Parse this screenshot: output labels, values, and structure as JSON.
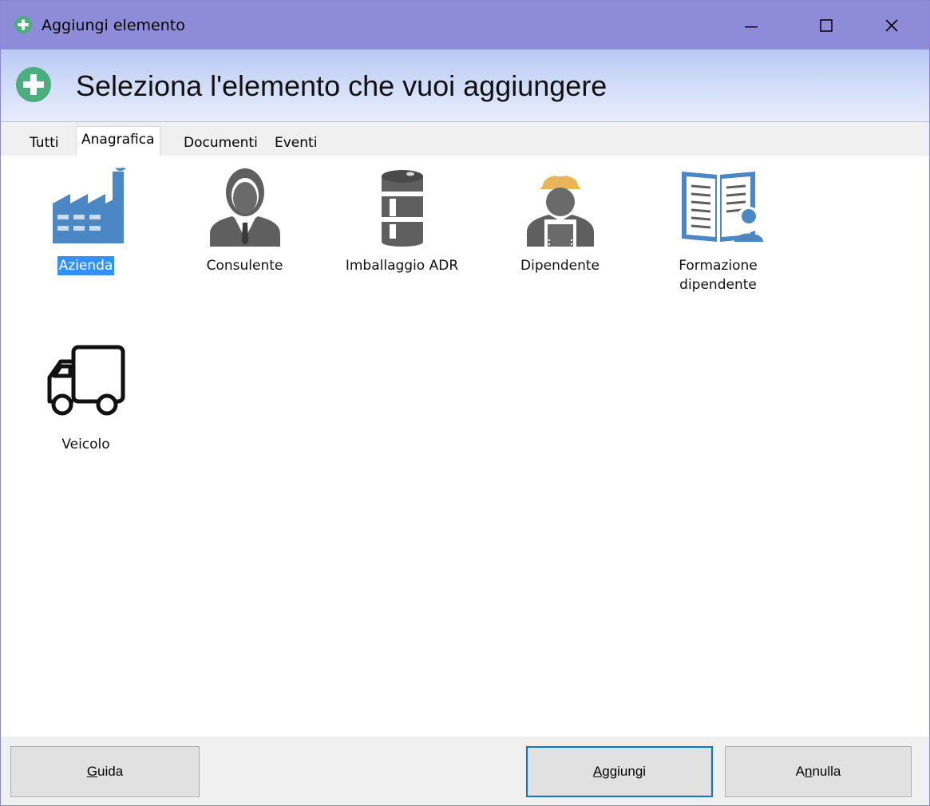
{
  "window": {
    "title": "Aggiungi elemento",
    "minimize": "—",
    "maximize": "☐",
    "close": "✕"
  },
  "header": {
    "title": "Seleziona l'elemento che vuoi aggiungere",
    "icon": "plus-circle-icon"
  },
  "tabs": [
    {
      "label": "Tutti",
      "active": false
    },
    {
      "label": "Anagrafica",
      "active": true
    },
    {
      "label": "Documenti",
      "active": false
    },
    {
      "label": "Eventi",
      "active": false
    }
  ],
  "items": [
    {
      "label": "Azienda",
      "icon": "factory-icon",
      "selected": true
    },
    {
      "label": "Consulente",
      "icon": "consultant-icon",
      "selected": false
    },
    {
      "label": "Imballaggio ADR",
      "icon": "barrel-icon",
      "selected": false
    },
    {
      "label": "Dipendente",
      "icon": "worker-icon",
      "selected": false
    },
    {
      "label_line1": "Formazione",
      "label_line2": "dipendente",
      "icon": "training-book-icon",
      "selected": false
    },
    {
      "label": "Veicolo",
      "icon": "truck-icon",
      "selected": false
    }
  ],
  "footer": {
    "help": {
      "accel": "G",
      "rest": "uida"
    },
    "add": {
      "accel": "A",
      "rest": "ggiungi"
    },
    "cancel": {
      "pre": "A",
      "accel": "n",
      "rest": "nulla"
    }
  },
  "colors": {
    "titlebar": "#8e8bd8",
    "accent_green": "#4cae7e",
    "selection": "#3390ff",
    "icon_gray": "#666666",
    "icon_blue": "#4a87c4",
    "helmet": "#e8b55a"
  }
}
